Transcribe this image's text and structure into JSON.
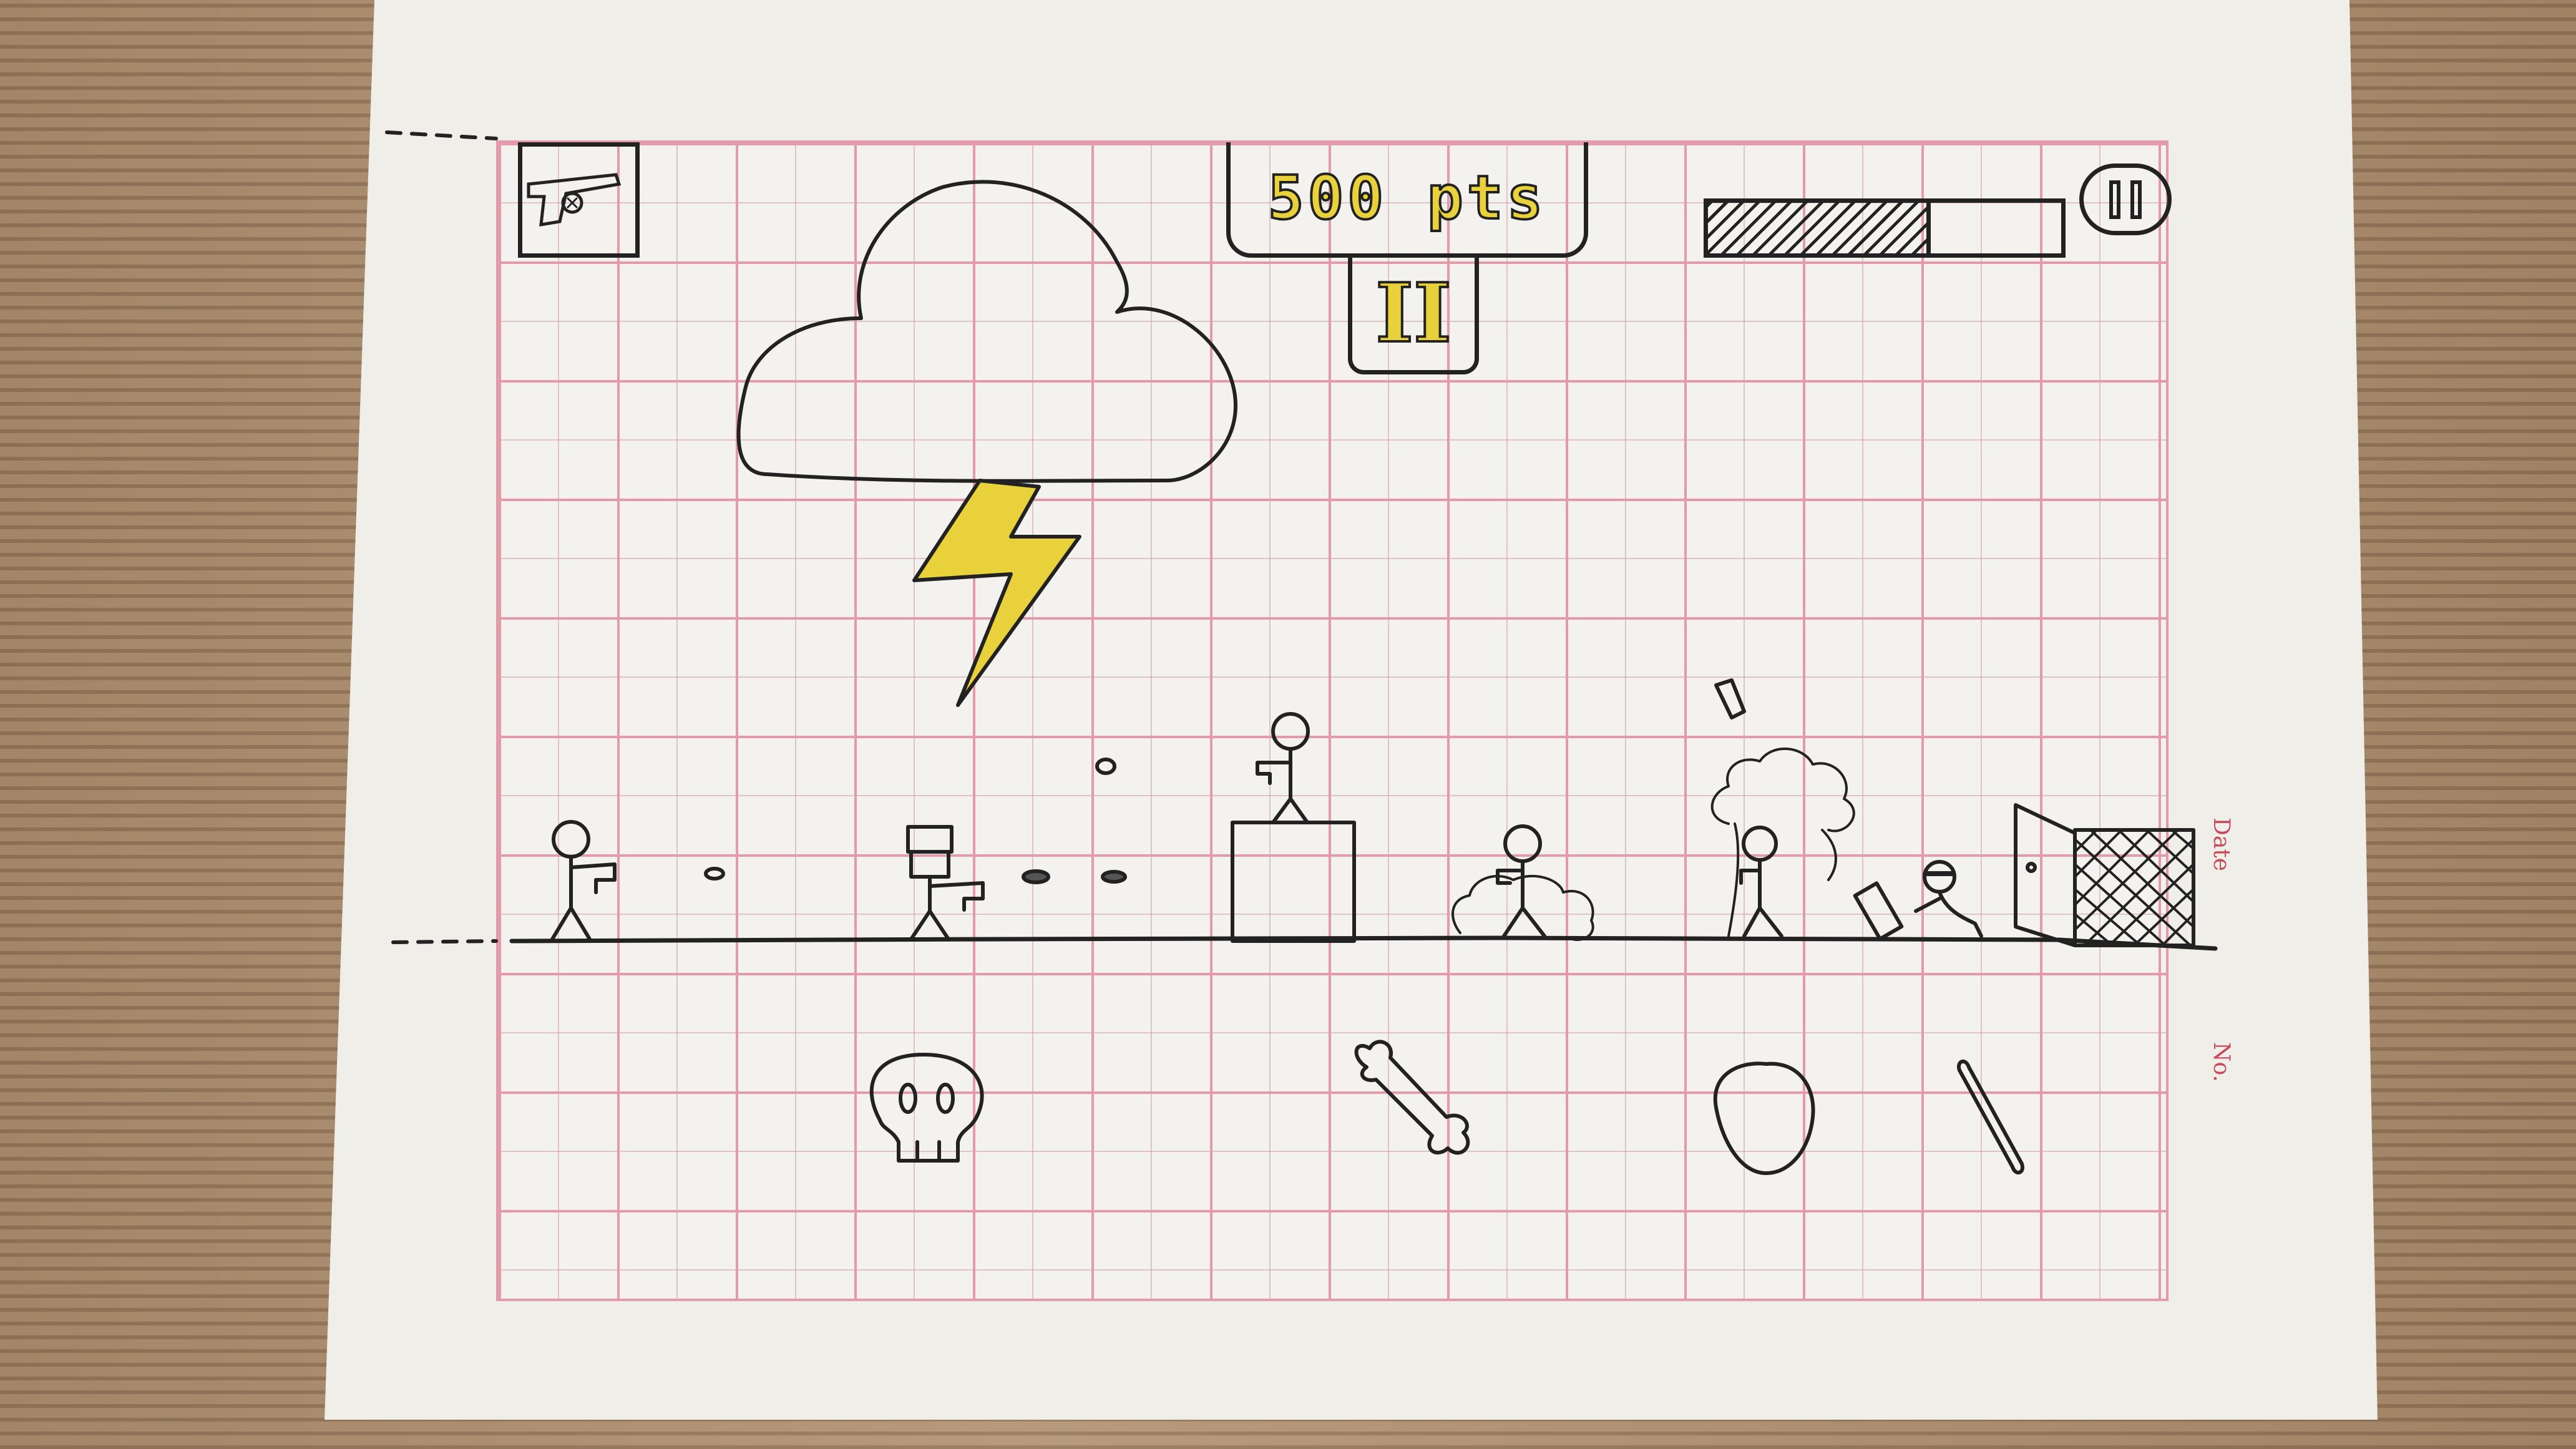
{
  "hud": {
    "weapon_icon": "revolver-icon",
    "score": "500 pts",
    "level": "II",
    "health_fraction": 0.63,
    "pause_icon": "pause-icon"
  },
  "paper_labels": {
    "date": "Date",
    "no": "No."
  },
  "colors": {
    "paper": "#efeee9",
    "grid_line": "#e49aa8",
    "ink": "#222222",
    "highlight_yellow": "#e8d13a",
    "background_wood": "#a8896a"
  },
  "scene": {
    "weather": [
      "cloud-icon",
      "lightning-bolt-icon"
    ],
    "characters": [
      "player-stickman",
      "box-head-stickman",
      "stickman-on-crate",
      "stickman-in-smoke",
      "stickman-under-tree",
      "crouching-stickman"
    ],
    "items": [
      "skull-icon",
      "bone-icon",
      "rock-icon",
      "stick-icon"
    ],
    "exit": "exit-door"
  }
}
